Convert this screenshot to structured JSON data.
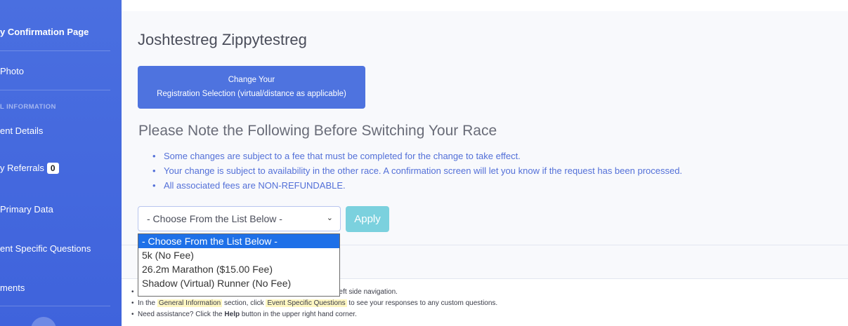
{
  "sidebar": {
    "items": [
      {
        "label": "y Confirmation Page"
      },
      {
        "label": "Photo"
      },
      {
        "label": "ent Details"
      },
      {
        "label": "y Referrals"
      },
      {
        "label": "Primary Data"
      },
      {
        "label": "ent Specific Questions"
      },
      {
        "label": "ments"
      }
    ],
    "heading": "L INFORMATION",
    "referrals_count": "0"
  },
  "main": {
    "title": "Joshtestreg Zippytestreg",
    "change_button": {
      "line1": "Change Your",
      "line2": "Registration Selection (virtual/distance as applicable)"
    },
    "note_title": "Please Note the Following Before Switching Your Race",
    "notes": [
      "Some changes are subject to a fee that must be completed for the change to take effect.",
      "Your change is subject to availability in the other race. A confirmation screen will let you know if the request has been processed.",
      "All associated fees are NON-REFUNDABLE."
    ],
    "select": {
      "value": "- Choose From the List Below -"
    },
    "apply_label": "Apply",
    "dropdown_options": [
      "- Choose From the List Below -",
      "5k (No Fee)",
      "26.2m Marathon ($15.00 Fee)",
      "Shadow (Virtual) Runner (No Fee)"
    ],
    "info": {
      "line1_tail": "e left side navigation.",
      "line2_pre": "In the",
      "line2_hl1": "General Information",
      "line2_mid": "section, click",
      "line2_hl2": "Event Specific Questions",
      "line2_post": "to see your responses to any custom questions.",
      "line3_pre": "Need assistance? Click the",
      "line3_bold": "Help",
      "line3_post": "button in the upper right hand corner."
    }
  },
  "colors": {
    "sidebar": "#4a6fe0",
    "primary": "#4e73df",
    "info": "#7bd1de",
    "select_highlight": "#1e70e8"
  }
}
